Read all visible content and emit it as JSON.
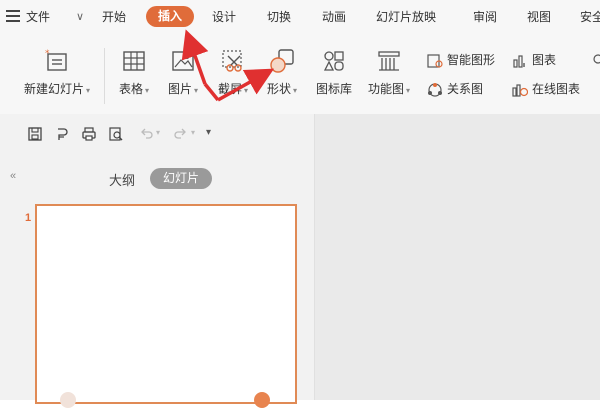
{
  "menu": {
    "file_label": "文件",
    "tabs": [
      "开始",
      "插入",
      "设计",
      "切换",
      "动画",
      "幻灯片放映",
      "审阅",
      "视图",
      "安全"
    ],
    "active_tab": "插入"
  },
  "ribbon": {
    "new_slide": "新建幻灯片",
    "table": "表格",
    "picture": "图片",
    "screenshot": "截屏",
    "shape": "形状",
    "icon_library": "图标库",
    "function_chart": "功能图",
    "smart_art": "智能图形",
    "relation_chart": "关系图",
    "chart": "图表",
    "online_chart": "在线图表"
  },
  "panel": {
    "outline_tab": "大纲",
    "slides_tab": "幻灯片",
    "slide_number": "1"
  },
  "colors": {
    "accent": "#e06c3a",
    "arrow": "#e03030"
  }
}
